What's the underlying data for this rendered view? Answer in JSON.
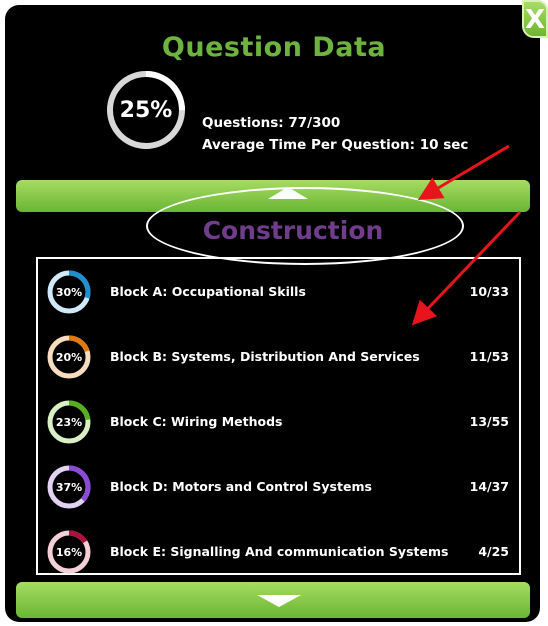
{
  "window": {
    "title": "Question Data",
    "close_label": "X"
  },
  "summary": {
    "percent": 25,
    "percent_label": "25%",
    "questions_text": "Questions: 77/300",
    "avg_time_text": "Average Time Per Question: 10 sec"
  },
  "section": {
    "title": "Construction"
  },
  "colors": {
    "accent_green": "#6db33f",
    "section_purple": "#6f3d8b",
    "annotation_red": "#e8141c"
  },
  "blocks": [
    {
      "percent": 30,
      "percent_label": "30%",
      "label": "Block A: Occupational Skills",
      "count": "10/33",
      "ring_color": "#1f8fd0",
      "track_color": "#cfe9f8"
    },
    {
      "percent": 20,
      "percent_label": "20%",
      "label": "Block B: Systems, Distribution And Services",
      "count": "11/53",
      "ring_color": "#e07a10",
      "track_color": "#f8dcc0"
    },
    {
      "percent": 23,
      "percent_label": "23%",
      "label": "Block C: Wiring Methods",
      "count": "13/55",
      "ring_color": "#55b020",
      "track_color": "#d8f0c4"
    },
    {
      "percent": 37,
      "percent_label": "37%",
      "label": "Block D: Motors and Control Systems",
      "count": "14/37",
      "ring_color": "#8a4bd8",
      "track_color": "#e2d2f4"
    },
    {
      "percent": 16,
      "percent_label": "16%",
      "label": "Block E: Signalling And communication Systems",
      "count": "4/25",
      "ring_color": "#b0103c",
      "track_color": "#f3cfd8"
    }
  ],
  "icons": {
    "collapse": "triangle-up-icon",
    "expand": "triangle-down-icon"
  }
}
